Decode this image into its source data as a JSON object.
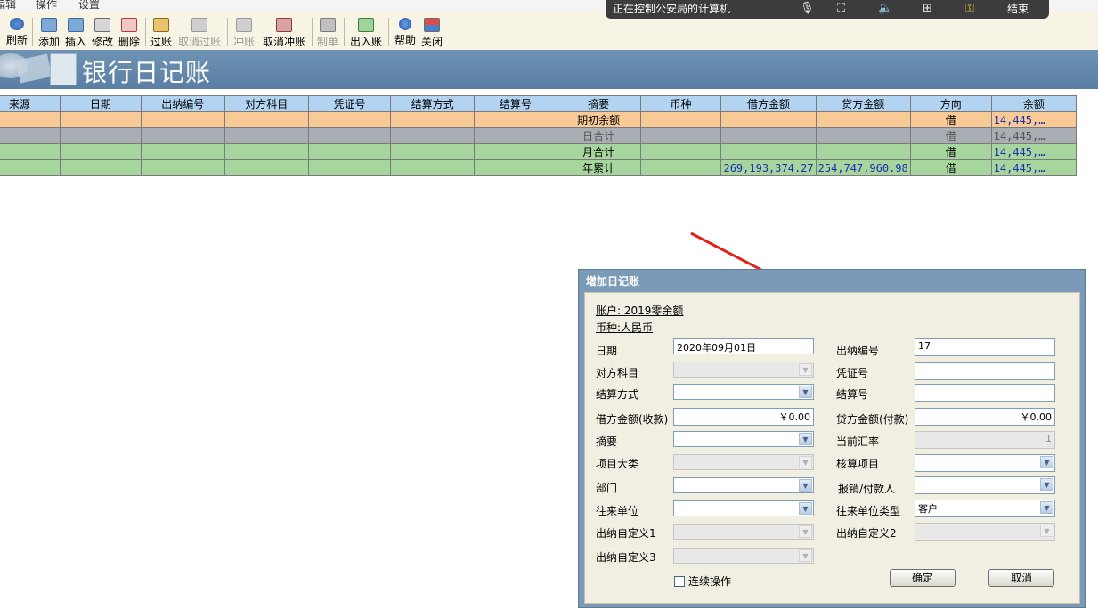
{
  "menu": {
    "items": [
      "编辑",
      "操作",
      "设置"
    ]
  },
  "toolbar": {
    "refresh": "刷新",
    "add": "添加",
    "insert": "插入",
    "modify": "修改",
    "delete": "删除",
    "post": "过账",
    "unpost": "取消过账",
    "reverse": "冲账",
    "unreverse": "取消冲账",
    "voucher": "制单",
    "in_out": "出入账",
    "help": "帮助",
    "close": "关闭"
  },
  "overlay": {
    "text": "正在控制公安局的计算机",
    "end": "结束"
  },
  "banner": {
    "title": "银行日记账"
  },
  "table": {
    "headers": [
      "来源",
      "日期",
      "出纳编号",
      "对方科目",
      "凭证号",
      "结算方式",
      "结算号",
      "摘要",
      "币种",
      "借方金额",
      "贷方金额",
      "方向",
      "余额"
    ],
    "rows": [
      {
        "summary": "期初余额",
        "debit": "",
        "credit": "",
        "direction": "借",
        "balance": "14,445,…"
      },
      {
        "summary": "日合计",
        "debit": "",
        "credit": "",
        "direction": "借",
        "balance": "14,445,…"
      },
      {
        "summary": "月合计",
        "debit": "",
        "credit": "",
        "direction": "借",
        "balance": "14,445,…"
      },
      {
        "summary": "年累计",
        "debit": "269,193,374.27",
        "credit": "254,747,960.98",
        "direction": "借",
        "balance": "14,445,…"
      }
    ]
  },
  "dialog": {
    "title": "增加日记账",
    "account": "账户: 2019零余额",
    "currency": "币种:人民币",
    "date_label": "日期",
    "date_value": "2020年09月01日",
    "cashier_no_label": "出纳编号",
    "cashier_no_value": "17",
    "counter_account_label": "对方科目",
    "voucher_no_label": "凭证号",
    "settle_method_label": "结算方式",
    "settle_no_label": "结算号",
    "debit_label": "借方金额(收款)",
    "debit_value": "￥0.00",
    "credit_label": "贷方金额(付款)",
    "credit_value": "￥0.00",
    "summary_label": "摘要",
    "exchange_rate_label": "当前汇率",
    "exchange_rate_value": "1",
    "project_category_label": "项目大类",
    "accounting_item_label": "核算项目",
    "department_label": "部门",
    "payee_label": "报销/付款人",
    "partner_label": "往来单位",
    "partner_type_label": "往来单位类型",
    "partner_type_value": "客户",
    "custom1_label": "出纳自定义1",
    "custom2_label": "出纳自定义2",
    "custom3_label": "出纳自定义3",
    "continuous_label": "连续操作",
    "ok_label": "确定",
    "cancel_label": "取消"
  },
  "colors": {
    "banner": "#6485a9",
    "header": "#b2d4f2",
    "opening_row": "#f9c996",
    "day_row": "#a8aeb3",
    "total_row": "#a6d69d",
    "arrow": "#e0231c"
  }
}
